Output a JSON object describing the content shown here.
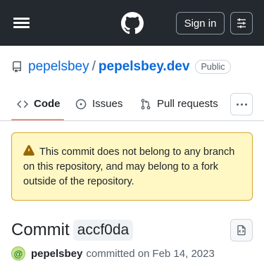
{
  "header": {
    "signin_label": "Sign in",
    "icons": [
      "hamburger-menu-icon",
      "github-logo-icon",
      "sliders-icon"
    ]
  },
  "repo": {
    "owner": "pepelsbey",
    "separator": "/",
    "name": "pepelsbey.dev",
    "visibility": "Public"
  },
  "tabs": [
    {
      "label": "Code",
      "icon": "code-icon",
      "selected": true
    },
    {
      "label": "Issues",
      "icon": "issue-icon",
      "selected": false
    },
    {
      "label": "Pull requests",
      "icon": "pull-request-icon",
      "selected": false
    }
  ],
  "flash": {
    "message": "This commit does not belong to any branch on this repository, and may belong to a fork outside of the repository.",
    "icon": "alert-icon"
  },
  "commit": {
    "title_word": "Commit",
    "sha": "accf0da",
    "author": "pepelsbey",
    "action": "committed on",
    "date": "Feb 14, 2023",
    "avatar_glyph": "@"
  },
  "colors": {
    "header_bg": "#24292f",
    "link": "#0969da",
    "tab_underline": "#fd8c73",
    "flash_bg": "#fff8c5",
    "flash_border": "#d4a72c"
  }
}
